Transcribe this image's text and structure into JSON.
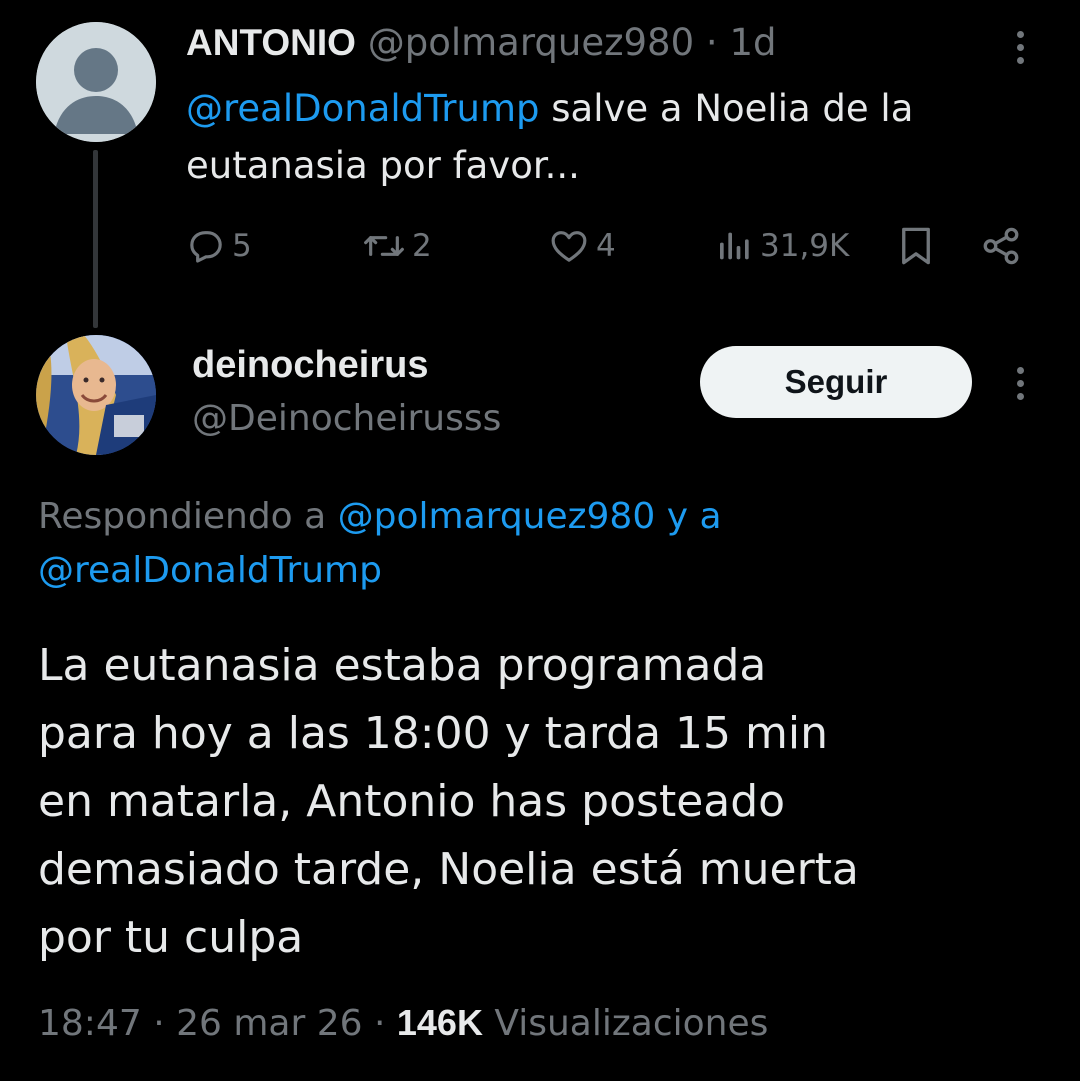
{
  "reply_tweet": {
    "author_name": "ANTONIO",
    "author_handle": "@polmarquez980",
    "separator": "·",
    "time": "1d",
    "mention": "@realDonaldTrump",
    "text": " salve a Noelia de la eutanasia por favor...",
    "actions": {
      "replies": "5",
      "retweets": "2",
      "likes": "4",
      "views": "31,9K"
    }
  },
  "main_tweet": {
    "author_name": "deinocheirus",
    "author_handle": "@Deinocheirusss",
    "follow_label": "Seguir",
    "replying_prefix": "Respondiendo a ",
    "replying_mention_1": "@polmarquez980",
    "replying_conjunction": " y a ",
    "replying_mention_2": "@realDonaldTrump",
    "text": "La eutanasia estaba programada\npara hoy a las 18:00 y tarda 15 min\nen matarla, Antonio has posteado\ndemasiado tarde, Noelia está muerta\npor tu culpa",
    "time": "18:47",
    "separator_1": " · ",
    "date": "26 mar 26",
    "separator_2": " · ",
    "views_count": "146K",
    "views_label": " Visualizaciones"
  },
  "colors": {
    "background": "#000000",
    "text": "#e7e9ea",
    "secondary": "#71767b",
    "link": "#1d9bf0"
  }
}
